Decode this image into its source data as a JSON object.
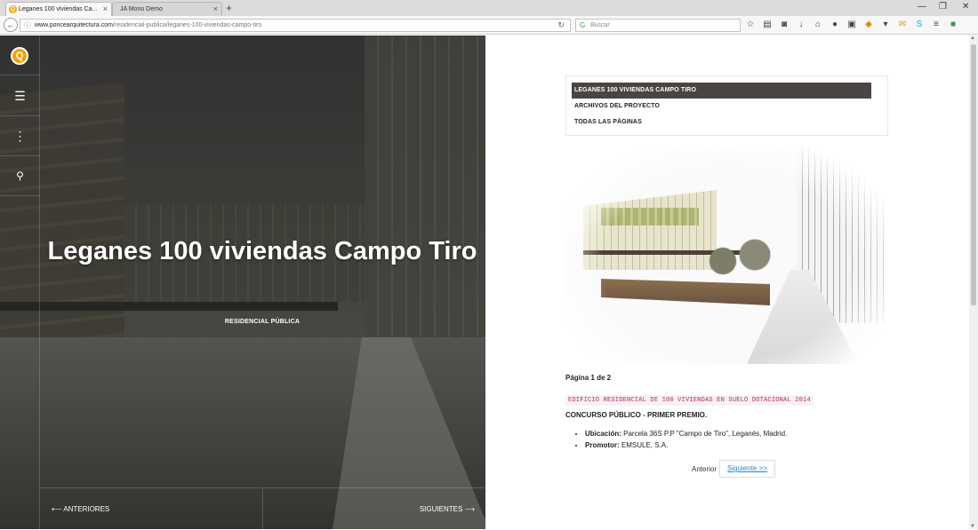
{
  "browser": {
    "tabs": [
      {
        "title": "Leganes 100 viviendas Ca...",
        "active": true,
        "favicon": "Q"
      },
      {
        "title": "JA Mono Demo",
        "active": false
      }
    ],
    "url_domain": "www.poncearquitectura.com",
    "url_path": "/residencial-publica/leganes-100-viviendas-campo-tiro",
    "search_placeholder": "Buscar",
    "toolbar_icons": [
      "star-icon",
      "clipboard-icon",
      "pocket-icon",
      "download-icon",
      "home-icon",
      "chat-icon",
      "extension-icon",
      "addon-icon",
      "menu-dropdown-icon",
      "mail-icon",
      "skype-icon",
      "menu-icon",
      "addon-green-icon"
    ]
  },
  "hero": {
    "title": "Leganes 100 viviendas Campo Tiro",
    "category": "RESIDENCIAL PÚBLICA",
    "prev_label": "⟵ ANTERIORES",
    "next_label": "SIGUIENTES ⟶"
  },
  "sidebar": {
    "logo": "Q",
    "items": [
      "menu-icon",
      "more-vertical-icon",
      "search-icon"
    ]
  },
  "article": {
    "toc": [
      {
        "label": "LEGANES 100 VIVIENDAS CAMPO TIRO",
        "active": true
      },
      {
        "label": "ARCHIVOS DEL PROYECTO",
        "active": false
      },
      {
        "label": "TODAS LAS PÁGINAS",
        "active": false
      }
    ],
    "page_info": "Página 1 de 2",
    "code_line": "EDIFICIO RESIDENCIAL DE 100 VIVIENDAS EN SUELO DOTACIONAL 2014",
    "heading": "CONCURSO PÚBLICO - PRIMER PREMIO.",
    "details": [
      {
        "label": "Ubicación:",
        "value": " Parcela 36S P.P \"Campo de Tiro\", Leganés, Madrid."
      },
      {
        "label": "Promotor:",
        "value": " EMSULE, S.A."
      }
    ],
    "prev_text": "Anterior",
    "next_button": "Siguiente >>"
  },
  "colors": {
    "accent_logo": "#f0a500",
    "toc_active_bg": "#4a4542",
    "code_text": "#c7254e",
    "link": "#1e88c7"
  }
}
